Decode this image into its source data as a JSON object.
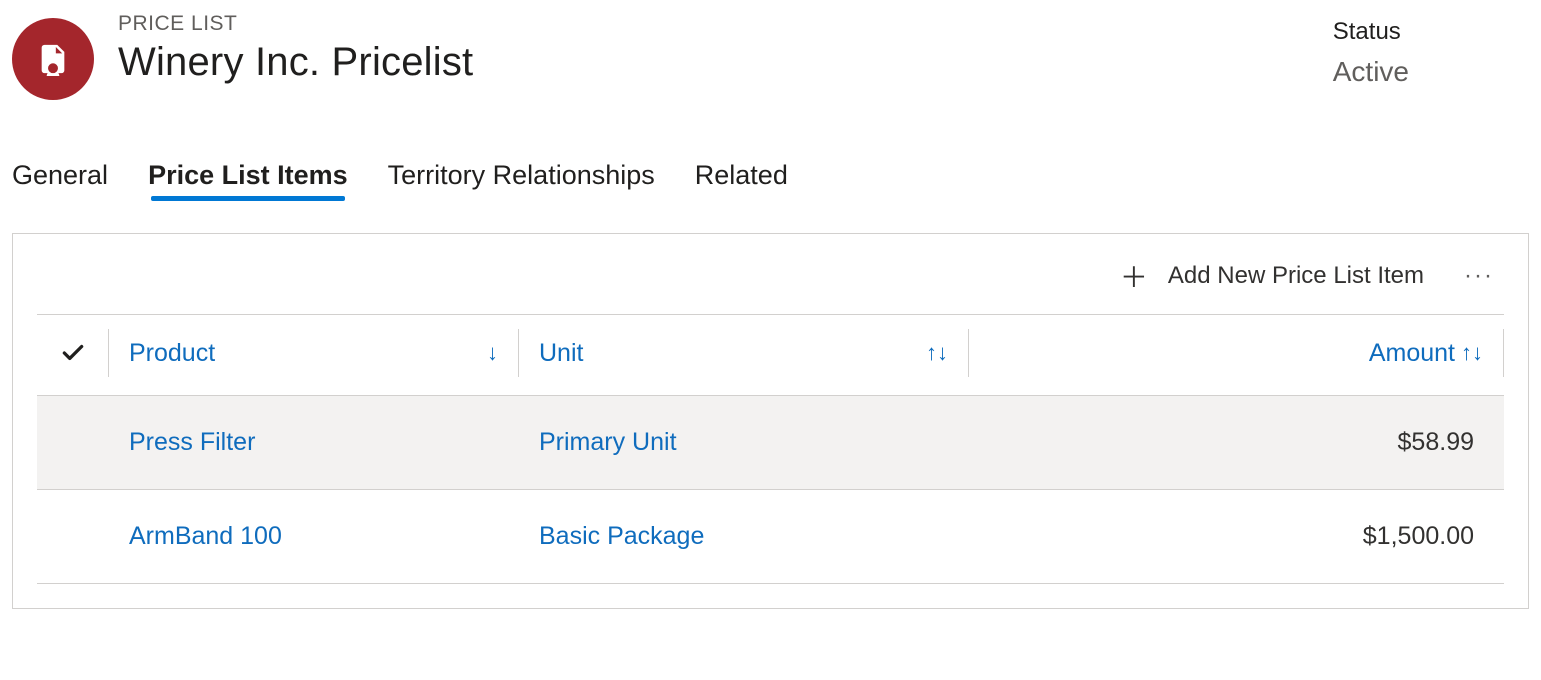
{
  "header": {
    "entity_type": "PRICE LIST",
    "title": "Winery Inc. Pricelist",
    "status_label": "Status",
    "status_value": "Active"
  },
  "tabs": {
    "general": "General",
    "items": "Price List Items",
    "territory": "Territory Relationships",
    "related": "Related",
    "active": "items"
  },
  "subgrid": {
    "add_label": "Add New Price List Item",
    "columns": {
      "product": "Product",
      "unit": "Unit",
      "amount": "Amount"
    },
    "rows": [
      {
        "product": "Press Filter",
        "unit": "Primary Unit",
        "amount": "$58.99"
      },
      {
        "product": "ArmBand 100",
        "unit": "Basic Package",
        "amount": "$1,500.00"
      }
    ]
  }
}
